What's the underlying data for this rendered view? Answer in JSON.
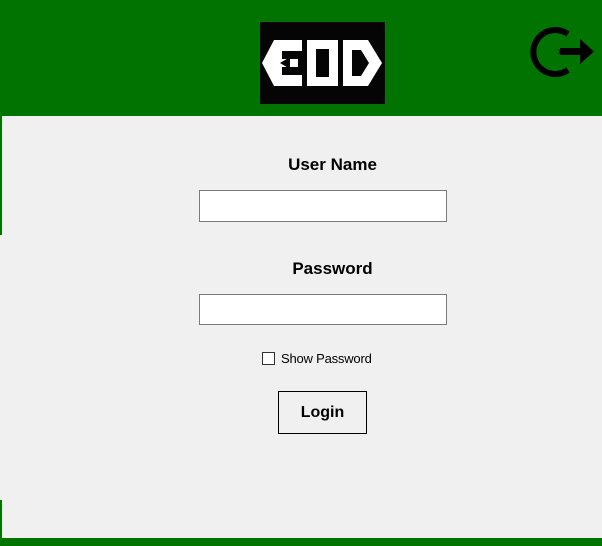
{
  "header": {
    "logo_text": "EOD",
    "exit_icon": "logout-icon",
    "background_color": "#007300"
  },
  "form": {
    "username_label": "User Name",
    "username_value": "",
    "password_label": "Password",
    "password_value": "",
    "show_password_label": "Show Password",
    "show_password_checked": false,
    "login_label": "Login"
  },
  "footer": {
    "background_color": "#007300"
  }
}
